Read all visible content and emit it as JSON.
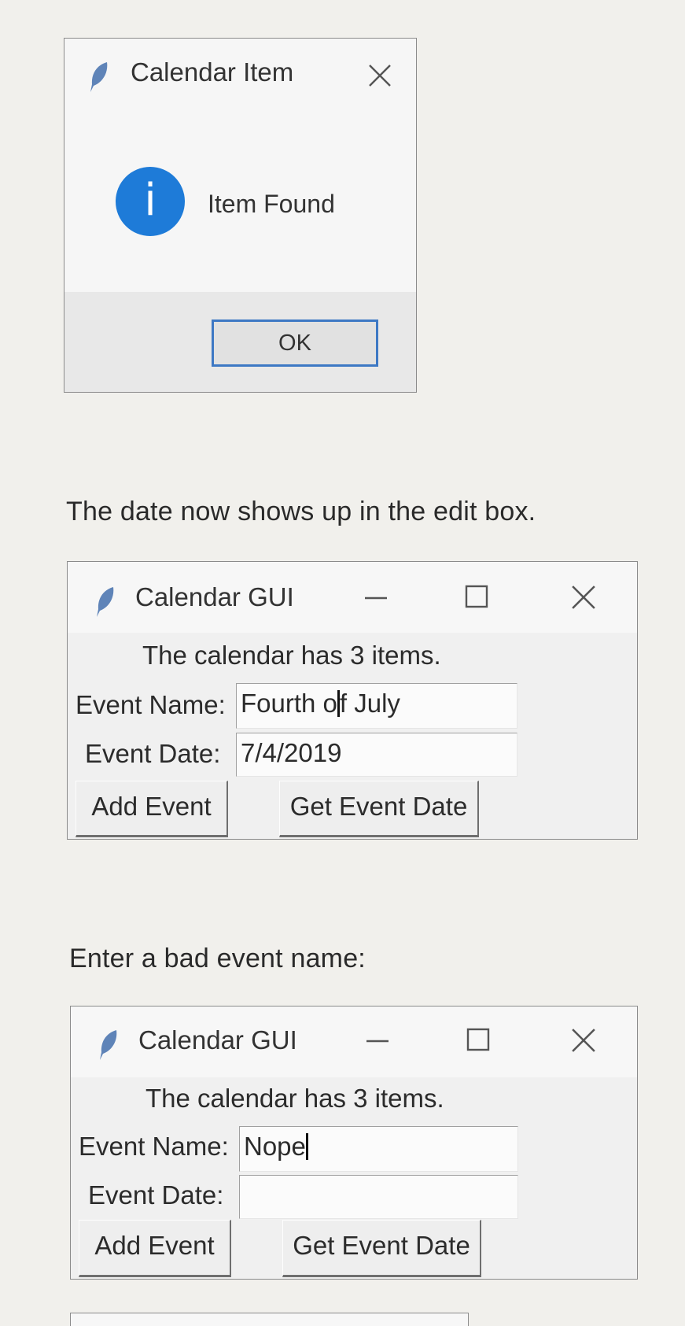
{
  "message_dialog": {
    "title": "Calendar Item",
    "message": "Item Found",
    "ok_label": "OK",
    "info_glyph": "i",
    "icons": {
      "app": "feather-icon",
      "info": "info-icon",
      "close": "close-icon"
    },
    "accent_color": "#1e7bd8"
  },
  "caption_1": "The date now shows up in the edit box.",
  "gui_1": {
    "title": "Calendar GUI",
    "status": "The calendar has 3 items.",
    "event_name_label": "Event Name:",
    "event_name_value_before_caret": "Fourth o",
    "event_name_value_after_caret": "f July",
    "event_date_label": "Event Date:",
    "event_date_value": "7/4/2019",
    "add_label": "Add Event",
    "get_label": "Get Event Date"
  },
  "caption_2": "Enter a bad event name:",
  "gui_2": {
    "title": "Calendar GUI",
    "status": "The calendar has 3 items.",
    "event_name_label": "Event Name:",
    "event_name_value": "Nope",
    "event_date_label": "Event Date:",
    "event_date_value": "",
    "add_label": "Add Event",
    "get_label": "Get Event Date"
  }
}
